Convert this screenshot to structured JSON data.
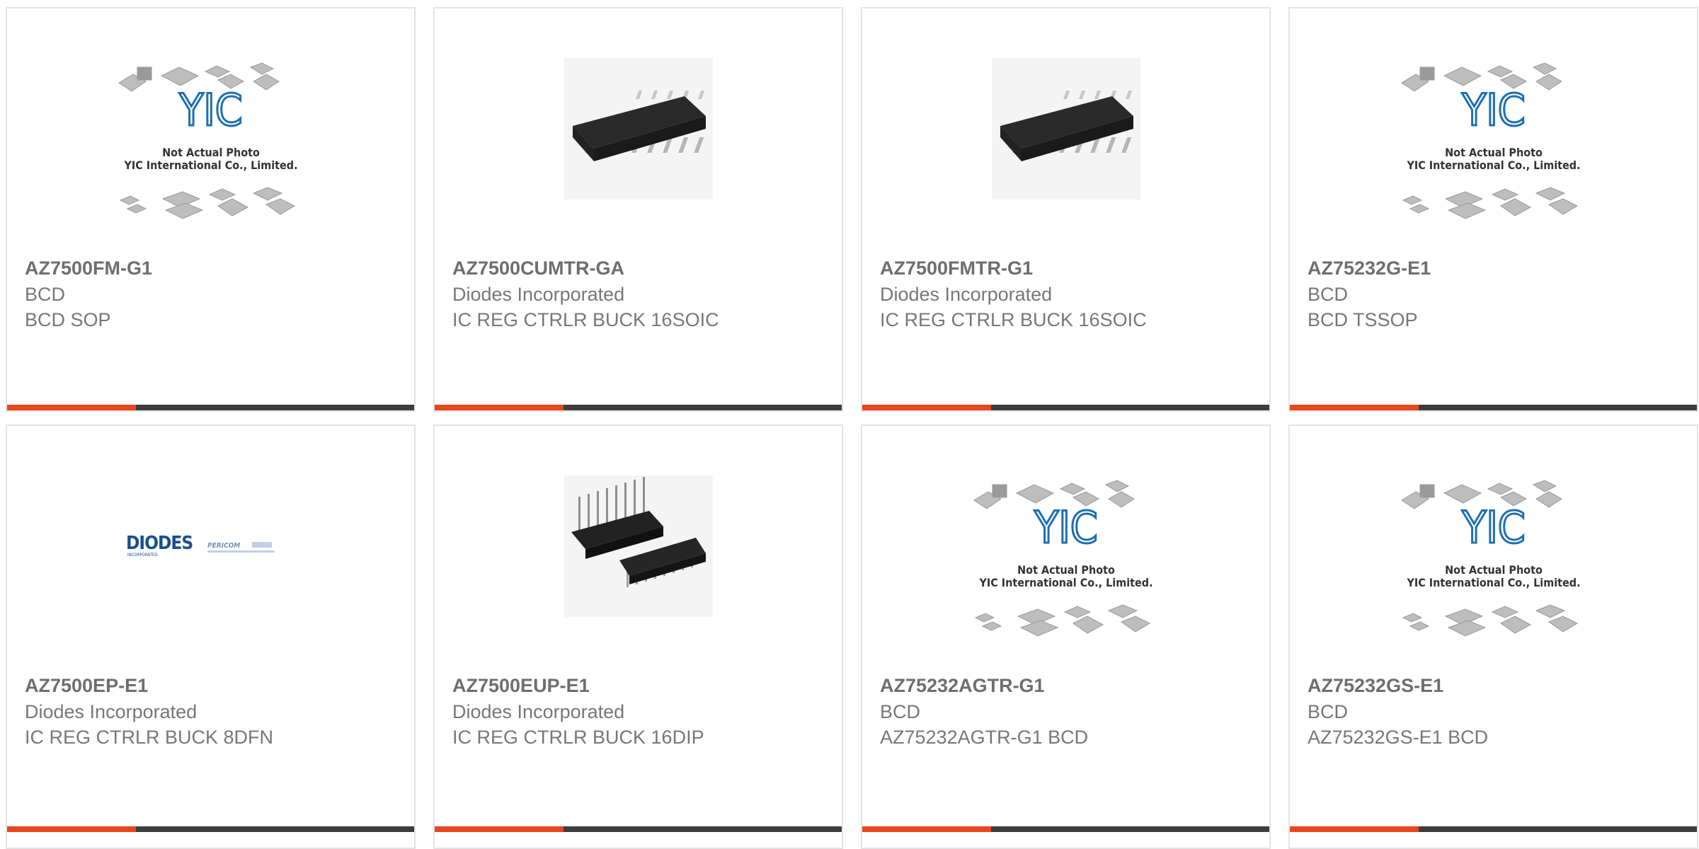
{
  "colors": {
    "accent": "#e8461d",
    "bar_dark": "#3d3d3d",
    "border": "#e3e3e3",
    "text": "#777777",
    "yic_blue": "#1f6fb2",
    "diodes_blue": "#1a4f8b"
  },
  "placeholder": {
    "brand": "YIC",
    "line1": "Not Actual Photo",
    "line2": "YIC International Co., Limited."
  },
  "diodes_logo": {
    "brand": "DIODES",
    "tagline": "INCORPORATED",
    "partner": "PERICOM"
  },
  "products": [
    {
      "part_number": "AZ7500FM-G1",
      "manufacturer": "BCD",
      "description": "BCD SOP",
      "image": "placeholder"
    },
    {
      "part_number": "AZ7500CUMTR-GA",
      "manufacturer": "Diodes Incorporated",
      "description": "IC REG CTRLR BUCK 16SOIC",
      "image": "soic-chip"
    },
    {
      "part_number": "AZ7500FMTR-G1",
      "manufacturer": "Diodes Incorporated",
      "description": "IC REG CTRLR BUCK 16SOIC",
      "image": "soic-chip"
    },
    {
      "part_number": "AZ75232G-E1",
      "manufacturer": "BCD",
      "description": "BCD TSSOP",
      "image": "placeholder"
    },
    {
      "part_number": "AZ7500EP-E1",
      "manufacturer": "Diodes Incorporated",
      "description": "IC REG CTRLR BUCK 8DFN",
      "image": "diodes-logo"
    },
    {
      "part_number": "AZ7500EUP-E1",
      "manufacturer": "Diodes Incorporated",
      "description": "IC REG CTRLR BUCK 16DIP",
      "image": "dip-chip"
    },
    {
      "part_number": "AZ75232AGTR-G1",
      "manufacturer": "BCD",
      "description": "AZ75232AGTR-G1 BCD",
      "image": "placeholder"
    },
    {
      "part_number": "AZ75232GS-E1",
      "manufacturer": "BCD",
      "description": "AZ75232GS-E1 BCD",
      "image": "placeholder"
    }
  ]
}
